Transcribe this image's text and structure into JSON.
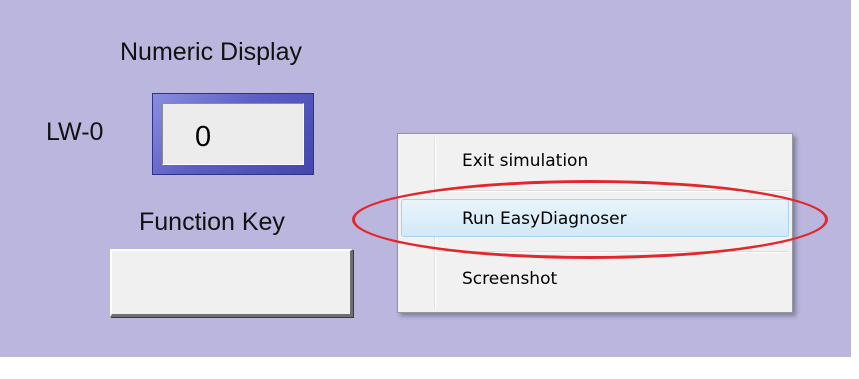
{
  "numeric_display": {
    "title": "Numeric Display",
    "address_label": "LW-0",
    "value": "0"
  },
  "function_key": {
    "title": "Function Key",
    "label": ""
  },
  "context_menu": {
    "items": [
      {
        "label": "Exit simulation"
      },
      {
        "label": "Run EasyDiagnoser",
        "highlighted": true
      },
      {
        "label": "Screenshot"
      }
    ]
  },
  "annotation": {
    "highlight_color": "#e3262b",
    "target": "Run EasyDiagnoser"
  },
  "colors": {
    "background": "#bab6dd",
    "display_frame": "#5c5fc4",
    "menu_hover": "#d2e9f7"
  }
}
